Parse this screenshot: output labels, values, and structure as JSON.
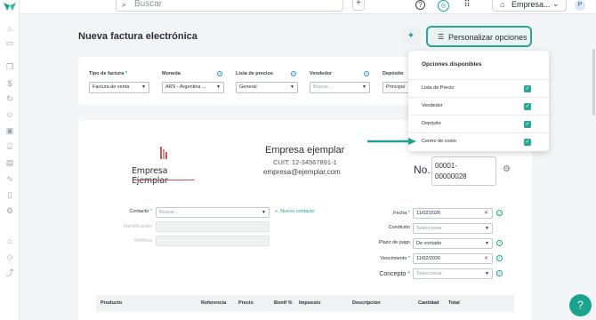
{
  "topbar": {
    "search_placeholder": "Buscar",
    "add_label": "+",
    "help_glyph": "?",
    "chat_glyph": "◎",
    "apps_glyph": "⠿",
    "company_label": "Empresa...",
    "avatar_initial": "P"
  },
  "sidebar": {
    "icons": [
      "home-icon",
      "inbox-icon",
      "documents-icon",
      "money-icon",
      "refresh-icon",
      "users-icon",
      "box-icon",
      "bank-icon",
      "receipt-icon",
      "trend-icon",
      "clipboard-icon",
      "settings-icon",
      "store-icon",
      "tag-icon",
      "chart-icon"
    ]
  },
  "page": {
    "title": "Nueva factura electrónica",
    "customize_label": "Personalizar opciones"
  },
  "filters": {
    "tipo": {
      "label": "Tipo de factura",
      "value": "Factura de venta"
    },
    "moneda": {
      "label": "Moneda",
      "value": "ARS - Argentina ..."
    },
    "lista": {
      "label": "Lista de precios",
      "value": "General"
    },
    "vendedor": {
      "label": "Vendedor",
      "value": "Buscar..."
    },
    "deposito": {
      "label": "Depósito",
      "value": "Principal"
    }
  },
  "company": {
    "logo_text": "Empresa Ejemplar",
    "name": "Empresa ejemplar",
    "cuit": "CUIT: 12-34567891-1",
    "email": "empresa@ejemplar.com"
  },
  "invoice": {
    "number_label": "No.",
    "number_line1": "00001-",
    "number_line2": "00000028"
  },
  "form": {
    "contacto_label": "Contacto",
    "contacto_placeholder": "Buscar...",
    "nuevo_contacto": "Nuevo contacto",
    "identificacion_label": "Identificación",
    "telefono_label": "Teléfono",
    "fecha_label": "Fecha",
    "fecha_value": "11/02/2026",
    "condicion_label": "Condición",
    "condicion_placeholder": "Seleccionar",
    "plazo_label": "Plazo de pago",
    "plazo_value": "De contado",
    "vencimiento_label": "Vencimiento",
    "vencimiento_value": "11/02/2026",
    "concepto_label": "Concepto",
    "concepto_placeholder": "Seleccionar"
  },
  "table": {
    "headers": [
      "Producto",
      "Referencia",
      "Precio",
      "Bonif %",
      "Impuesto",
      "Descripción",
      "Cantidad",
      "Total"
    ]
  },
  "dropdown": {
    "title": "Opciones disponibles",
    "items": [
      {
        "label": "Lista de Precio",
        "checked": true
      },
      {
        "label": "Vendedor",
        "checked": true
      },
      {
        "label": "Depósito",
        "checked": true
      },
      {
        "label": "Centro de costo",
        "checked": true
      }
    ]
  },
  "colors": {
    "accent": "#2aa793",
    "brand": "#1aa38f"
  }
}
